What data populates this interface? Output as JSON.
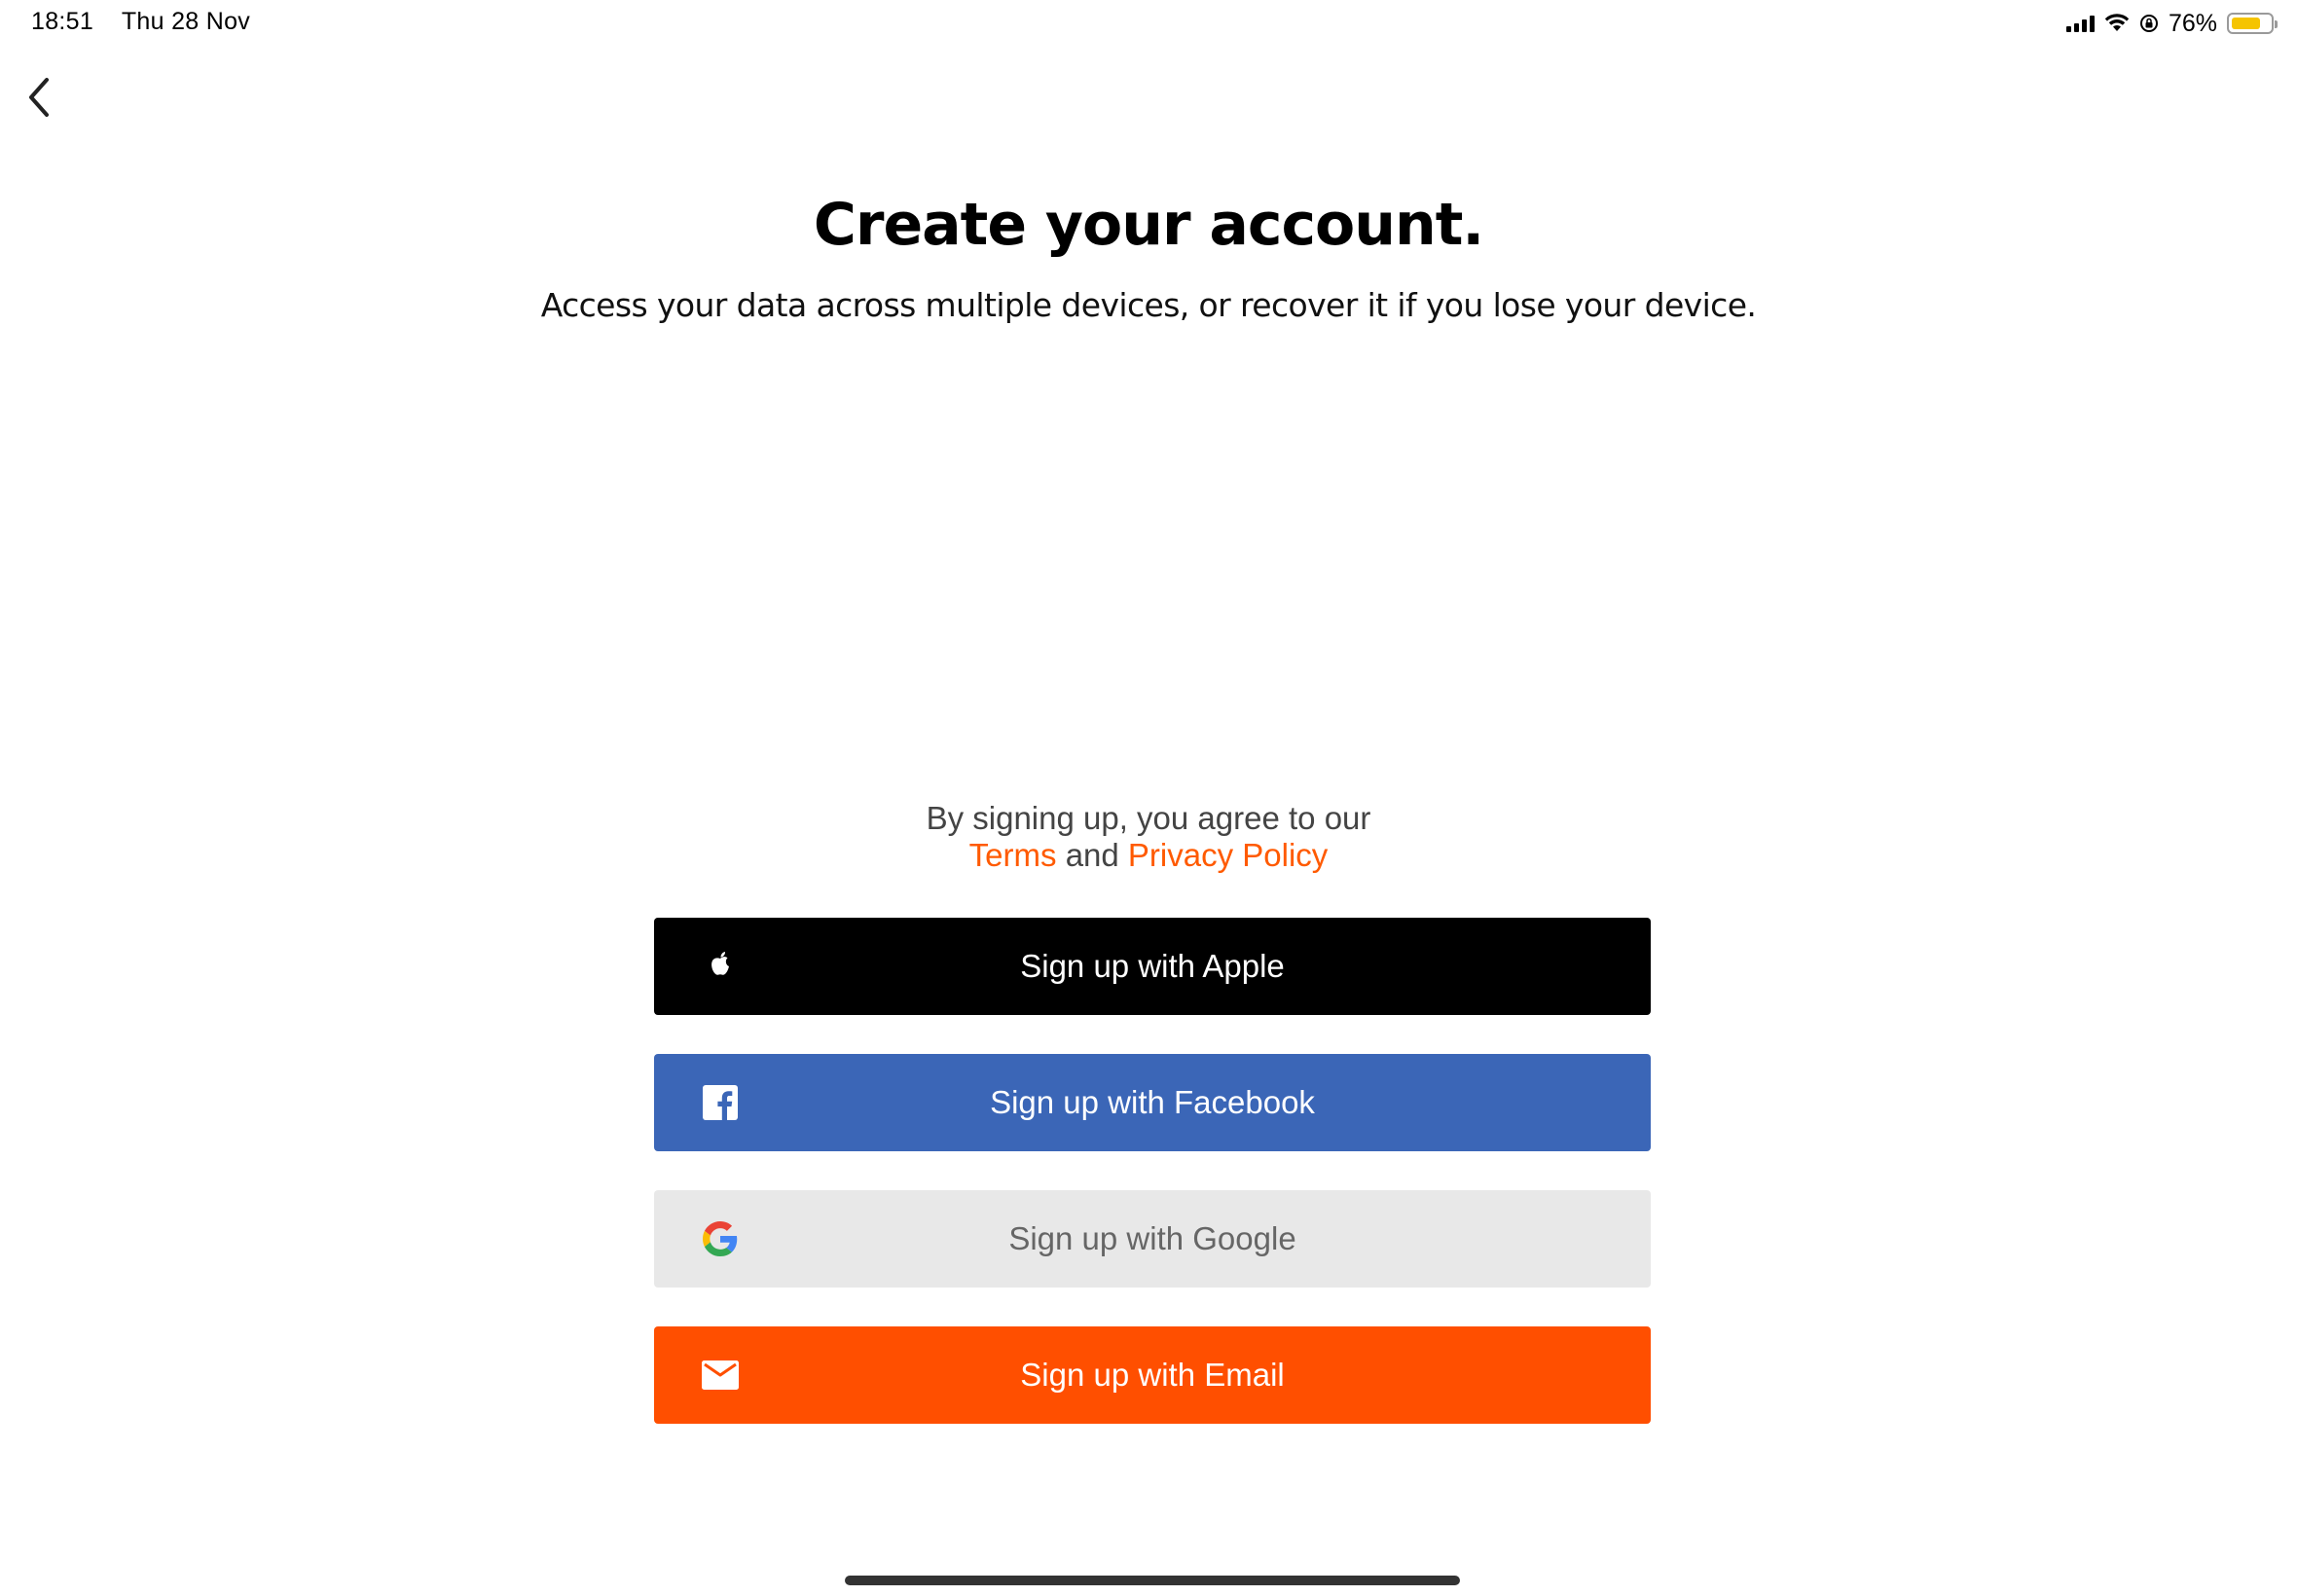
{
  "status_bar": {
    "time": "18:51",
    "date": "Thu 28 Nov",
    "battery_percent": "76%",
    "battery_level": 0.76
  },
  "header": {
    "title": "Create your account.",
    "subtitle": "Access your data across multiple devices, or recover it if you lose your device."
  },
  "legal": {
    "line1": "By signing up, you agree to our",
    "terms": "Terms",
    "and": "and",
    "privacy": "Privacy Policy"
  },
  "buttons": {
    "apple": "Sign up with Apple",
    "facebook": "Sign up with Facebook",
    "google": "Sign up with Google",
    "email": "Sign up with Email"
  },
  "colors": {
    "accent": "#ff5a00",
    "apple_bg": "#000000",
    "facebook_bg": "#3b66b7",
    "google_bg": "#e8e8e8",
    "email_bg": "#ff4f00"
  },
  "icons": {
    "back": "chevron-left-icon",
    "apple": "apple-icon",
    "facebook": "facebook-icon",
    "google": "google-icon",
    "email": "mail-icon"
  }
}
